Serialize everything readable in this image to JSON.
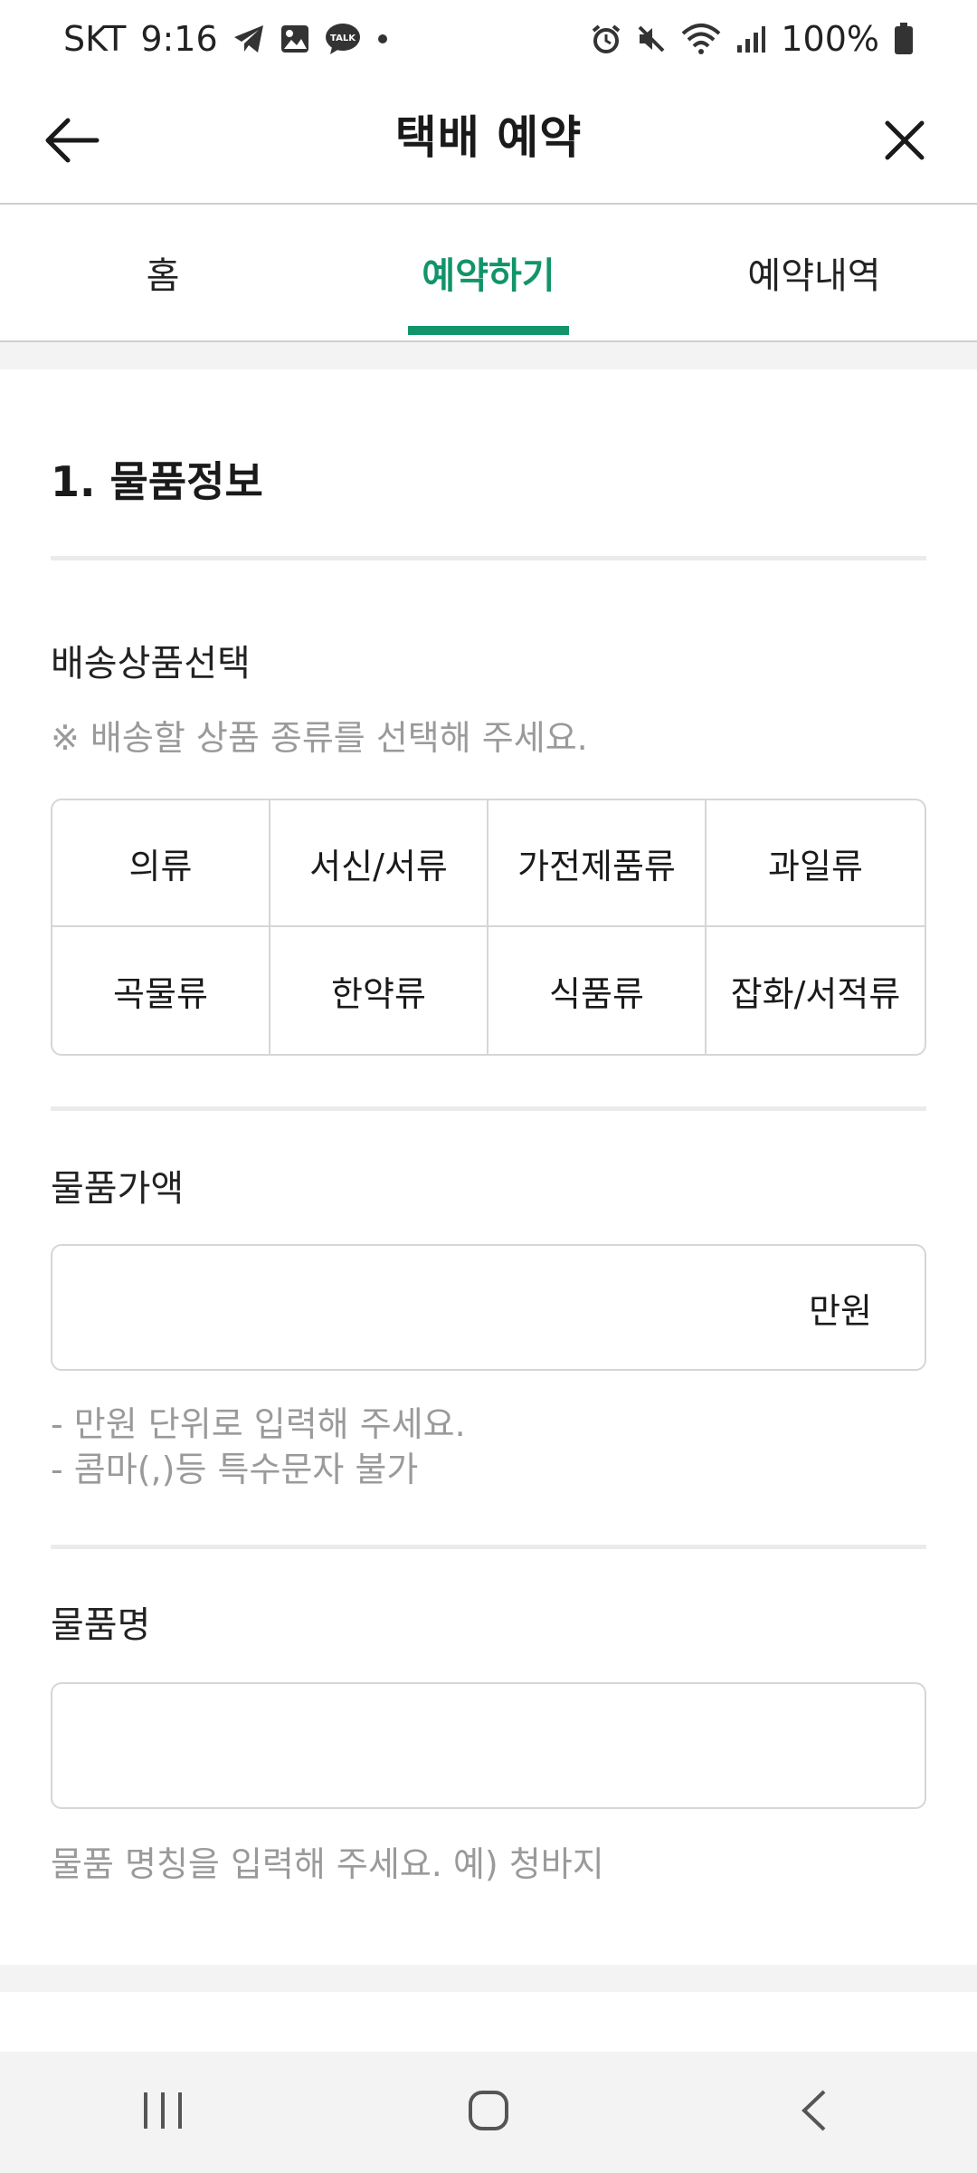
{
  "status_bar": {
    "carrier": "SKT",
    "time": "9:16",
    "battery": "100%",
    "notification_icons": [
      "telegram-icon",
      "gallery-icon",
      "kakaotalk-icon",
      "dot-icon"
    ],
    "kakaotalk_badge": "TALK",
    "system_icons": [
      "alarm-icon",
      "mute-icon",
      "wifi-icon",
      "signal-icon",
      "battery-icon"
    ]
  },
  "header": {
    "title": "택배 예약",
    "back_icon": "arrow-left-icon",
    "close_icon": "close-icon"
  },
  "tabs": [
    {
      "label": "홈",
      "active": false
    },
    {
      "label": "예약하기",
      "active": true
    },
    {
      "label": "예약내역",
      "active": false
    }
  ],
  "section": {
    "title": "1. 물품정보"
  },
  "product_select": {
    "label": "배송상품선택",
    "hint": "※ 배송할 상품 종류를 선택해 주세요.",
    "options": [
      "의류",
      "서신/서류",
      "가전제품류",
      "과일류",
      "곡물류",
      "한약류",
      "식품류",
      "잡화/서적류"
    ]
  },
  "price": {
    "label": "물품가액",
    "value": "",
    "unit": "만원",
    "hint_line1": "- 만원 단위로 입력해 주세요.",
    "hint_line2": "- 콤마(,)등 특수문자 불가"
  },
  "item_name": {
    "label": "물품명",
    "value": "",
    "hint": "물품 명칭을 입력해 주세요. 예) 청바지"
  },
  "colors": {
    "accent": "#12946a",
    "hint_text": "#9a9a9a",
    "border": "#d6d6d6"
  },
  "nav_bar": {
    "icons": [
      "recent-apps-icon",
      "home-icon",
      "back-icon"
    ]
  }
}
